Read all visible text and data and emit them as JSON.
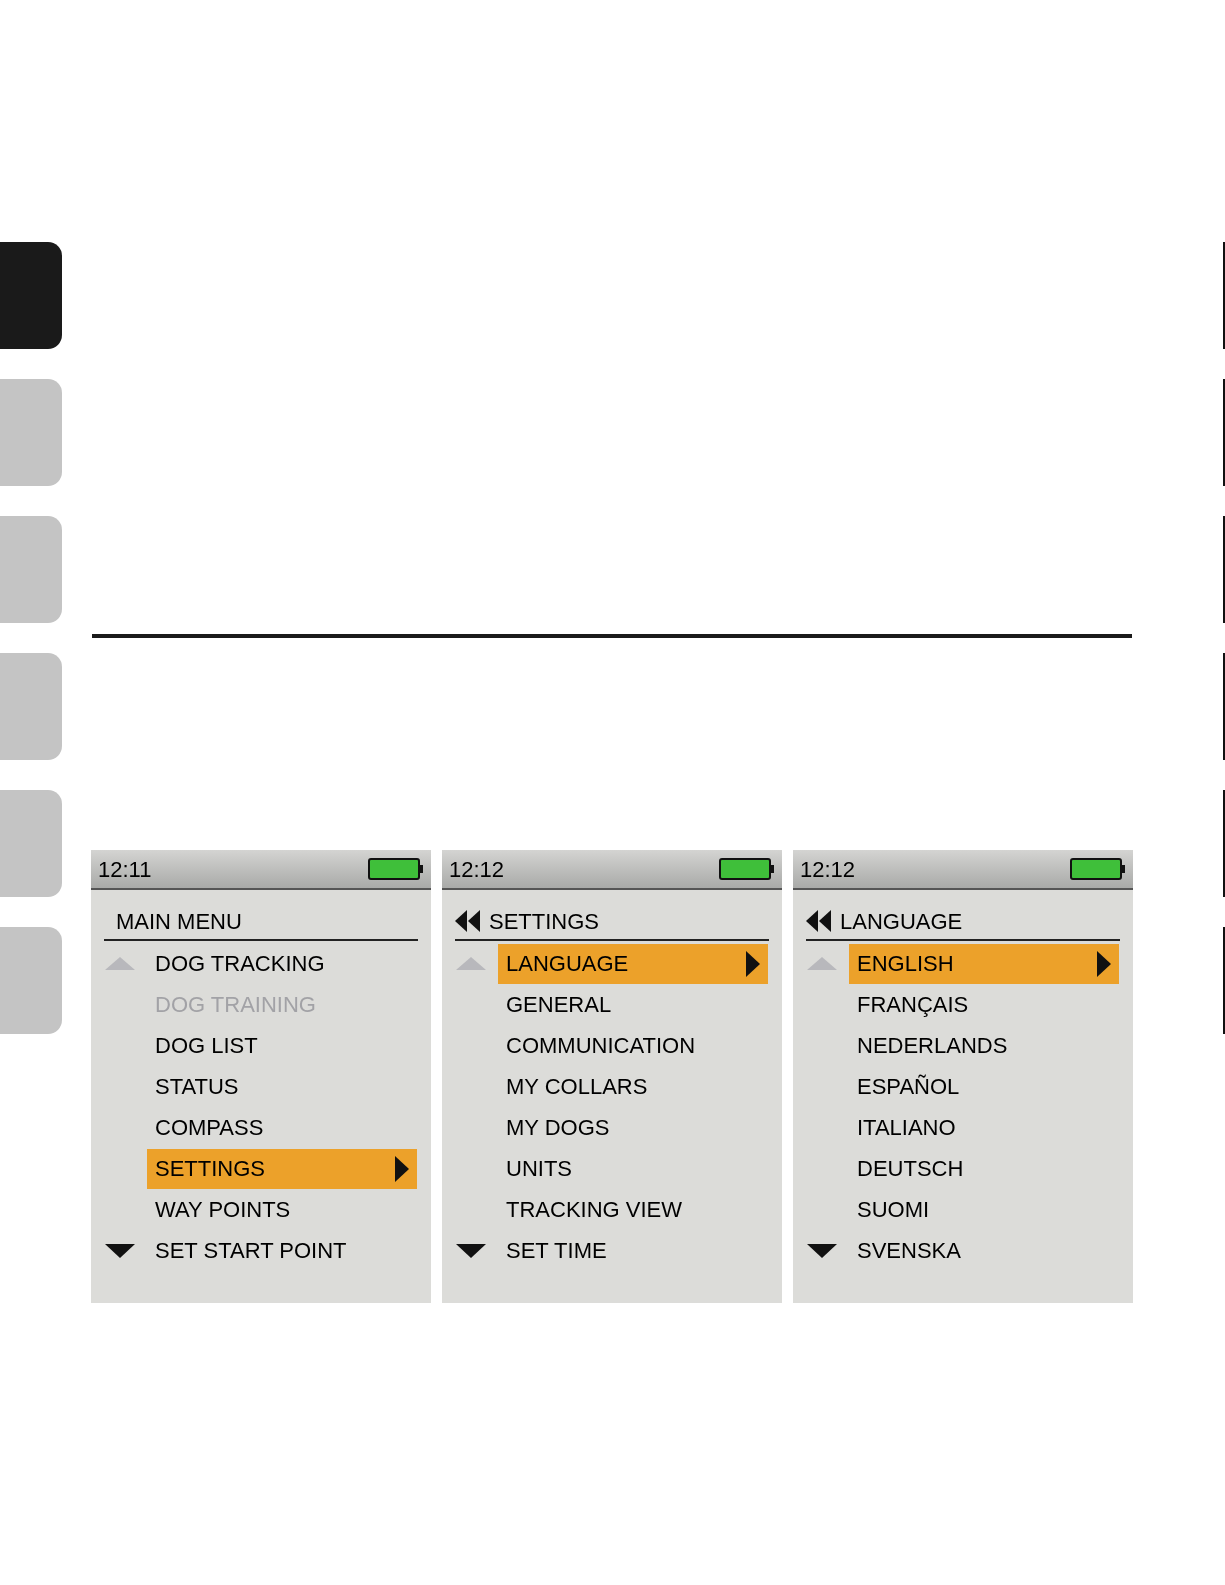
{
  "side_tabs": [
    {
      "selected": true
    },
    {
      "selected": false
    },
    {
      "selected": false
    },
    {
      "selected": false
    },
    {
      "selected": false
    },
    {
      "selected": false
    }
  ],
  "screens": [
    {
      "time": "12:11",
      "title": "MAIN MENU",
      "back": false,
      "items": [
        {
          "label": "DOG TRACKING",
          "selected": false,
          "disabled": false
        },
        {
          "label": "DOG TRAINING",
          "selected": false,
          "disabled": true
        },
        {
          "label": "DOG LIST",
          "selected": false,
          "disabled": false
        },
        {
          "label": "STATUS",
          "selected": false,
          "disabled": false
        },
        {
          "label": "COMPASS",
          "selected": false,
          "disabled": false
        },
        {
          "label": "SETTINGS",
          "selected": true,
          "disabled": false
        },
        {
          "label": "WAY POINTS",
          "selected": false,
          "disabled": false
        },
        {
          "label": "SET START POINT",
          "selected": false,
          "disabled": false
        }
      ]
    },
    {
      "time": "12:12",
      "title": "SETTINGS",
      "back": true,
      "items": [
        {
          "label": "LANGUAGE",
          "selected": true,
          "disabled": false
        },
        {
          "label": "GENERAL",
          "selected": false,
          "disabled": false
        },
        {
          "label": "COMMUNICATION",
          "selected": false,
          "disabled": false
        },
        {
          "label": "MY COLLARS",
          "selected": false,
          "disabled": false
        },
        {
          "label": "MY DOGS",
          "selected": false,
          "disabled": false
        },
        {
          "label": "UNITS",
          "selected": false,
          "disabled": false
        },
        {
          "label": "TRACKING VIEW",
          "selected": false,
          "disabled": false
        },
        {
          "label": "SET TIME",
          "selected": false,
          "disabled": false
        }
      ]
    },
    {
      "time": "12:12",
      "title": "LANGUAGE",
      "back": true,
      "items": [
        {
          "label": "ENGLISH",
          "selected": true,
          "disabled": false
        },
        {
          "label": "FRANÇAIS",
          "selected": false,
          "disabled": false
        },
        {
          "label": "NEDERLANDS",
          "selected": false,
          "disabled": false
        },
        {
          "label": "ESPAÑOL",
          "selected": false,
          "disabled": false
        },
        {
          "label": "ITALIANO",
          "selected": false,
          "disabled": false
        },
        {
          "label": "DEUTSCH",
          "selected": false,
          "disabled": false
        },
        {
          "label": "SUOMI",
          "selected": false,
          "disabled": false
        },
        {
          "label": "SVENSKA",
          "selected": false,
          "disabled": false
        }
      ]
    }
  ]
}
